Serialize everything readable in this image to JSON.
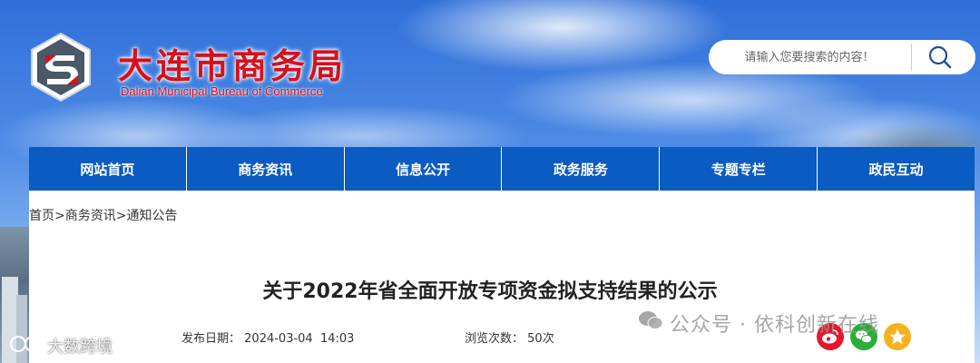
{
  "header": {
    "logo_title": "大连市商务局",
    "logo_subtitle": "Dalian  Municipal Bureau of Commerce"
  },
  "search": {
    "placeholder": "请输入您要搜索的内容！"
  },
  "nav": {
    "items": [
      {
        "label": "网站首页"
      },
      {
        "label": "商务资讯"
      },
      {
        "label": "信息公开"
      },
      {
        "label": "政务服务"
      },
      {
        "label": "专题专栏"
      },
      {
        "label": "政民互动"
      }
    ]
  },
  "breadcrumb": {
    "home": "首页",
    "section": "商务资讯",
    "current": "通知公告",
    "separator": ">"
  },
  "article": {
    "title": "关于2022年省全面开放专项资金拟支持结果的公示",
    "date_label": "发布日期：",
    "date_value": "2024-03-04  14:03",
    "views_label": "浏览次数：",
    "views_value": "50次"
  },
  "watermarks": {
    "right": "公众号 · 依科创新在线",
    "left": "大数跨境"
  },
  "colors": {
    "brand_red": "#d6101b",
    "nav_blue": "#0a5bc2",
    "weibo": "#e6162d",
    "wechat": "#2bad38",
    "qzone": "#f7b11d"
  }
}
